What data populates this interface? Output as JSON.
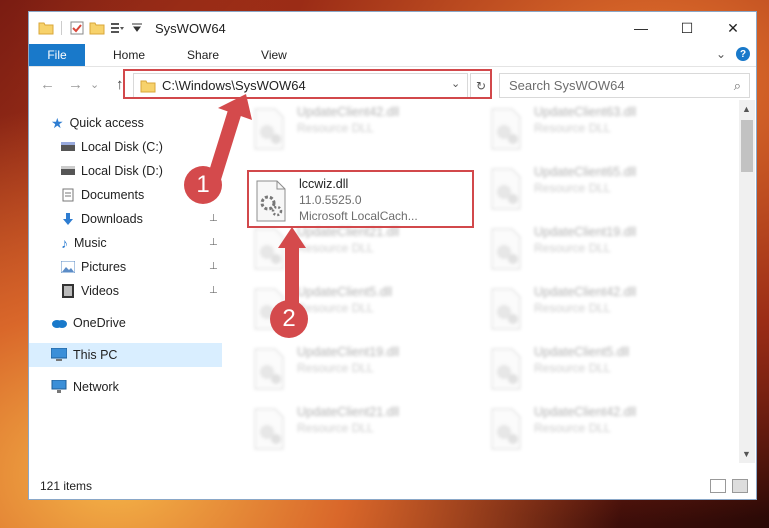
{
  "window": {
    "title": "SysWOW64",
    "minimize": "—",
    "maximize": "☐",
    "close": "✕"
  },
  "ribbon": {
    "tabs": [
      "File",
      "Home",
      "Share",
      "View"
    ],
    "expand": "⌄",
    "help": "?"
  },
  "nav": {
    "back": "←",
    "forward": "→",
    "recent": "⌄",
    "up": "↑"
  },
  "address": {
    "path": "C:\\Windows\\SysWOW64",
    "dropdown": "⌄",
    "refresh": "↻"
  },
  "search": {
    "placeholder": "Search SysWOW64",
    "icon": "⌕"
  },
  "sidebar": {
    "quick_access": "Quick access",
    "local_c": "Local Disk (C:)",
    "local_d": "Local Disk (D:)",
    "documents": "Documents",
    "downloads": "Downloads",
    "music": "Music",
    "pictures": "Pictures",
    "videos": "Videos",
    "onedrive": "OneDrive",
    "thispc": "This PC",
    "network": "Network",
    "pin": "📌"
  },
  "files": {
    "left": [
      {
        "name": "UpdateClient42.dll",
        "desc": "Resource DLL"
      },
      {
        "name": "UpdateClient21.dll",
        "desc": "Resource DLL"
      },
      {
        "name": "UpdateClient5.dll",
        "desc": "Resource DLL"
      },
      {
        "name": "UpdateClient19.dll",
        "desc": "Resource DLL"
      },
      {
        "name": "UpdateClient21.dll",
        "desc": "Resource DLL"
      }
    ],
    "right": [
      {
        "name": "UpdateClient63.dll",
        "desc": "Resource DLL"
      },
      {
        "name": "UpdateClient65.dll",
        "desc": "Resource DLL"
      },
      {
        "name": "UpdateClient19.dll",
        "desc": "Resource DLL"
      },
      {
        "name": "UpdateClient42.dll",
        "desc": "Resource DLL"
      },
      {
        "name": "UpdateClient5.dll",
        "desc": "Resource DLL"
      },
      {
        "name": "UpdateClient42.dll",
        "desc": "Resource DLL"
      }
    ],
    "highlighted": {
      "name": "lccwiz.dll",
      "version": "11.0.5525.0",
      "company": "Microsoft LocalCach..."
    }
  },
  "status": {
    "count": "121 items"
  },
  "annotations": {
    "one": "1",
    "two": "2"
  },
  "colors": {
    "accent": "#1979ca",
    "highlight_red": "#d2484b",
    "arrow_red": "#d44a4c"
  }
}
